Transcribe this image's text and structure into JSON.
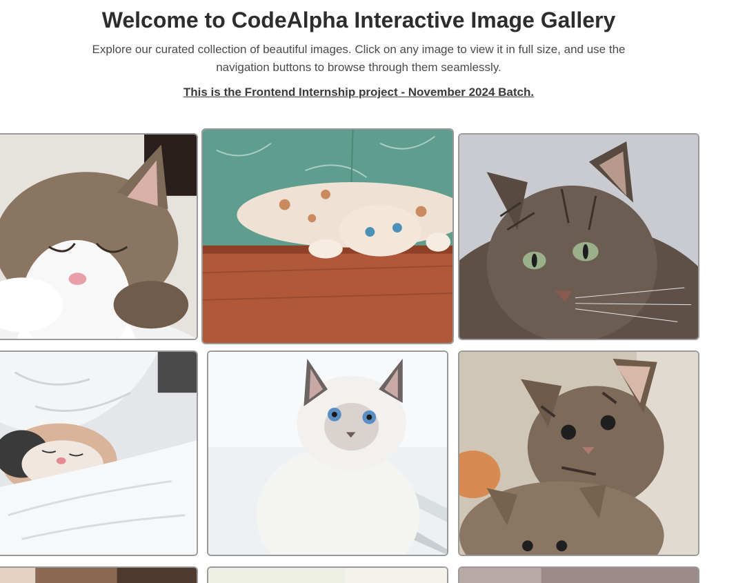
{
  "header": {
    "title": "Welcome to CodeAlpha Interactive Image Gallery",
    "description": "Explore our curated collection of beautiful images. Click on any image to view it in full size, and use the navigation buttons to browse through them seamlessly.",
    "batch_note": "This is the Frontend Internship project - November 2024 Batch."
  },
  "gallery": {
    "images": [
      {
        "subject": "sleeping tabby-and-white cat on white blanket",
        "background": "#d8d4cf"
      },
      {
        "subject": "cream cat lying upside down on wooden floor against teal marble wall",
        "background": "#5f9e8e"
      },
      {
        "subject": "long-haired tabby cat portrait",
        "background": "#c9cbd0"
      },
      {
        "subject": "cat sleeping under white duvet",
        "background": "#e4e6e9"
      },
      {
        "subject": "white siamese kitten with blue eyes",
        "background": "#eef1f3"
      },
      {
        "subject": "two tabby kittens",
        "background": "#cfc6b8"
      },
      {
        "subject": "partially visible image",
        "background": "#8a6a55"
      },
      {
        "subject": "partially visible image",
        "background": "#e8e8e0"
      },
      {
        "subject": "partially visible image",
        "background": "#a59a98"
      }
    ]
  }
}
